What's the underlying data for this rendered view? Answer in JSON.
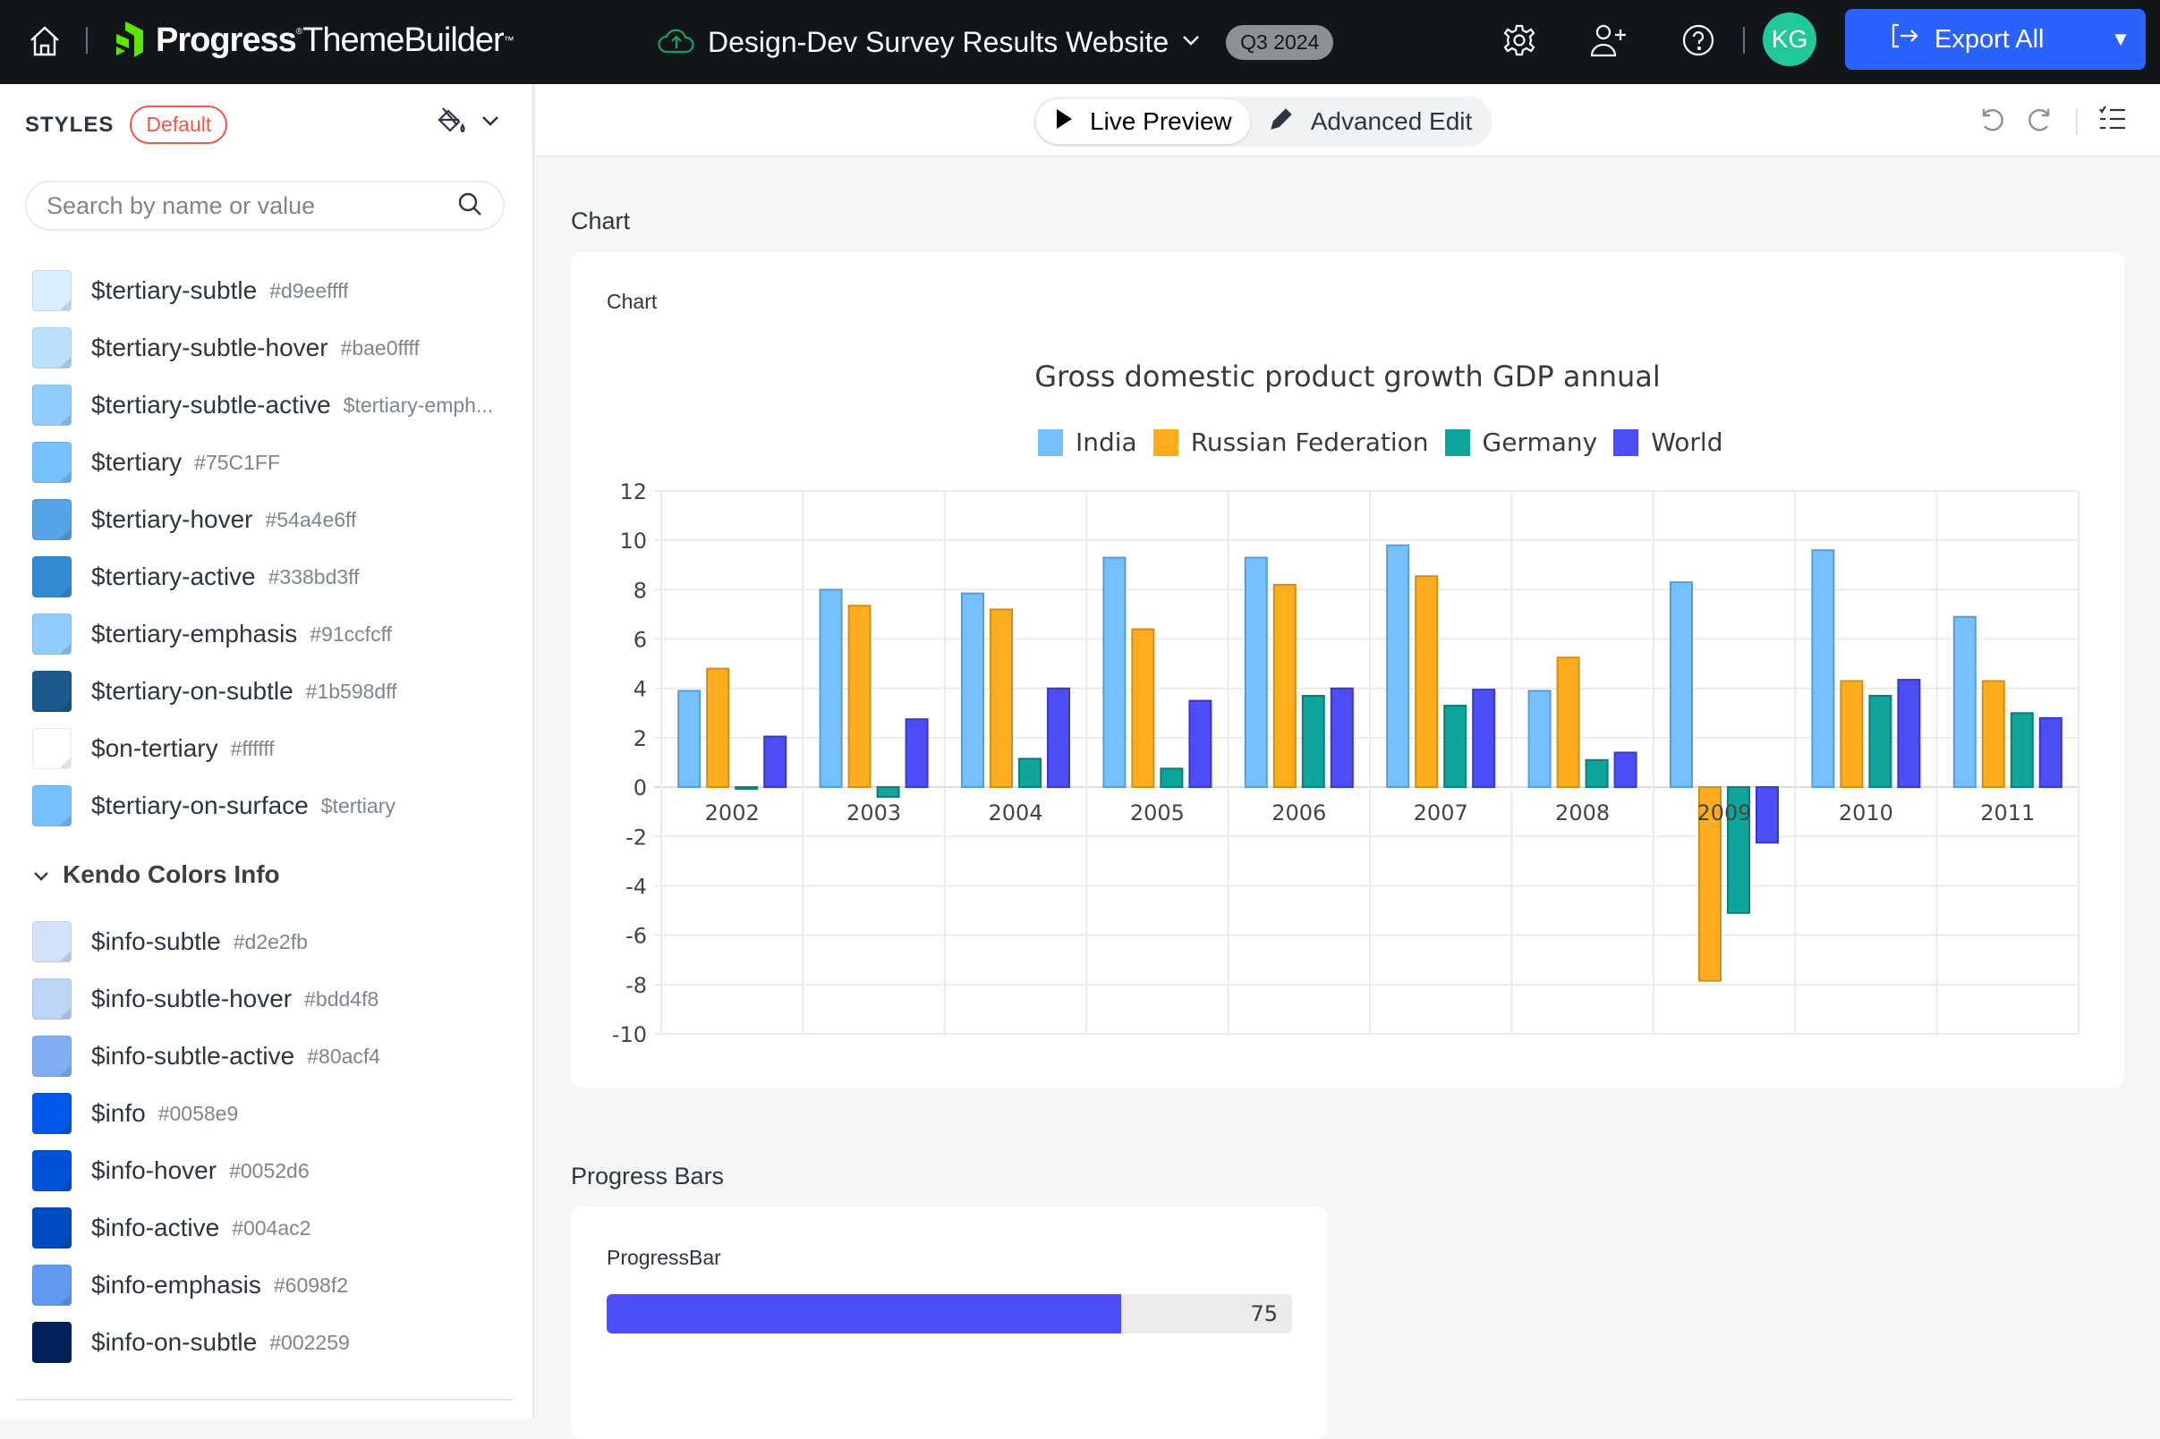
{
  "app": {
    "brand": "Progress",
    "product": "ThemeBuilder",
    "trademark": "™",
    "project_title": "Design-Dev Survey Results Website",
    "project_badge": "Q3 2024",
    "user_initials": "KG",
    "export_label": "Export All",
    "icons": [
      "home-icon",
      "cloud-upload-icon",
      "chevron-down-icon",
      "gear-icon",
      "add-user-icon",
      "help-icon",
      "export-icon",
      "caret-down-icon"
    ]
  },
  "sidebar": {
    "title": "STYLES",
    "style_badge": "Default",
    "search_placeholder": "Search by name or value",
    "tertiary_items": [
      {
        "name": "$tertiary-subtle",
        "value": "#d9eeffff",
        "color": "#d9eeff"
      },
      {
        "name": "$tertiary-subtle-hover",
        "value": "#bae0ffff",
        "color": "#bae0ff"
      },
      {
        "name": "$tertiary-subtle-active",
        "value": "$tertiary-emph...",
        "color": "#91ccfc"
      },
      {
        "name": "$tertiary",
        "value": "#75C1FF",
        "color": "#75c1ff"
      },
      {
        "name": "$tertiary-hover",
        "value": "#54a4e6ff",
        "color": "#54a4e6"
      },
      {
        "name": "$tertiary-active",
        "value": "#338bd3ff",
        "color": "#338bd3"
      },
      {
        "name": "$tertiary-emphasis",
        "value": "#91ccfcff",
        "color": "#91ccfc"
      },
      {
        "name": "$tertiary-on-subtle",
        "value": "#1b598dff",
        "color": "#1b598d"
      },
      {
        "name": "$on-tertiary",
        "value": "#ffffff",
        "color": "#ffffff"
      },
      {
        "name": "$tertiary-on-surface",
        "value": "$tertiary",
        "color": "#75c1ff"
      }
    ],
    "info_group_title": "Kendo Colors Info",
    "info_items": [
      {
        "name": "$info-subtle",
        "value": "#d2e2fb",
        "color": "#d2e2fb"
      },
      {
        "name": "$info-subtle-hover",
        "value": "#bdd4f8",
        "color": "#bdd4f8"
      },
      {
        "name": "$info-subtle-active",
        "value": "#80acf4",
        "color": "#80acf4"
      },
      {
        "name": "$info",
        "value": "#0058e9",
        "color": "#0058e9"
      },
      {
        "name": "$info-hover",
        "value": "#0052d6",
        "color": "#0052d6"
      },
      {
        "name": "$info-active",
        "value": "#004ac2",
        "color": "#004ac2"
      },
      {
        "name": "$info-emphasis",
        "value": "#6098f2",
        "color": "#6098f2"
      },
      {
        "name": "$info-on-subtle",
        "value": "#002259",
        "color": "#002259"
      }
    ]
  },
  "toolbar": {
    "live_preview_label": "Live Preview",
    "advanced_edit_label": "Advanced Edit",
    "active_mode": "Live Preview"
  },
  "main": {
    "chart_section_title": "Chart",
    "chart_card_label": "Chart",
    "progress_section_title": "Progress Bars",
    "progress_card_label": "ProgressBar",
    "progress_value": 75,
    "progress_max": 100,
    "progress_color": "#4e4ef6"
  },
  "chart_data": {
    "type": "bar",
    "title": "Gross domestic product growth GDP annual",
    "xlabel": "",
    "ylabel": "",
    "ylim": [
      -10,
      12
    ],
    "yticks": [
      12,
      10,
      8,
      6,
      4,
      2,
      0,
      -2,
      -4,
      -6,
      -8,
      -10
    ],
    "grid": true,
    "legend_position": "top",
    "categories": [
      "2002",
      "2003",
      "2004",
      "2005",
      "2006",
      "2007",
      "2008",
      "2009",
      "2010",
      "2011"
    ],
    "series": [
      {
        "name": "India",
        "color": "#75c1ff",
        "values": [
          3.9,
          8.0,
          7.85,
          9.3,
          9.3,
          9.8,
          3.9,
          8.3,
          9.6,
          6.9
        ]
      },
      {
        "name": "Russian Federation",
        "color": "#ffac1f",
        "values": [
          4.8,
          7.35,
          7.2,
          6.4,
          8.2,
          8.55,
          5.25,
          -7.85,
          4.3,
          4.3
        ]
      },
      {
        "name": "Germany",
        "color": "#0da59c",
        "values": [
          0.0,
          -0.4,
          1.15,
          0.75,
          3.7,
          3.3,
          1.1,
          -5.1,
          3.7,
          3.0
        ]
      },
      {
        "name": "World",
        "color": "#4e4ef6",
        "values": [
          2.05,
          2.75,
          4.0,
          3.5,
          4.0,
          3.95,
          1.4,
          -2.25,
          4.35,
          2.8
        ]
      }
    ]
  }
}
